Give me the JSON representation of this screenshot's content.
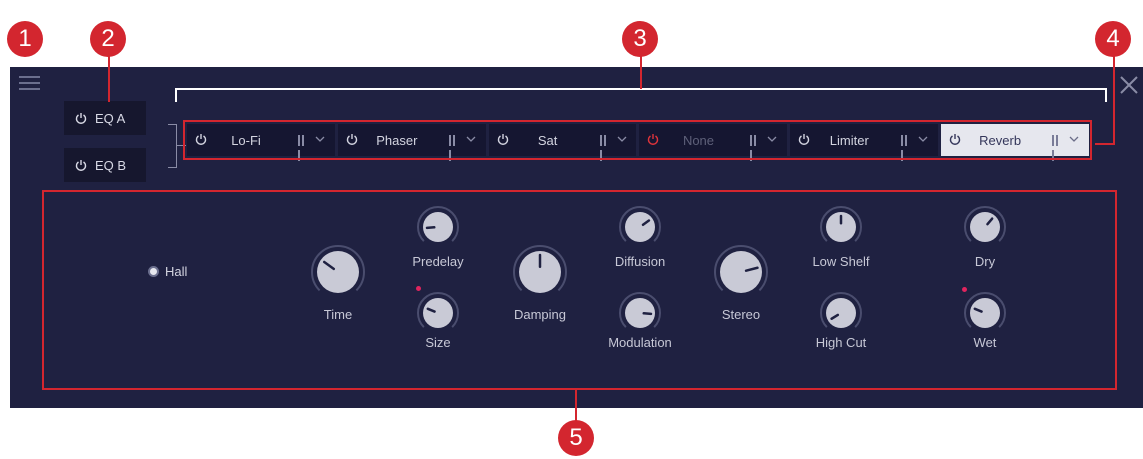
{
  "colors": {
    "panel": "#1f2141",
    "slot_bg": "#151631",
    "active_slot_bg": "#e6e7ee",
    "callout": "#d3262f",
    "modulation_dot": "#e0245e"
  },
  "icons": {
    "menu": "hamburger-icon",
    "close": "close-icon",
    "power": "power-icon",
    "bars": "bars-icon",
    "chevron": "chevron-down-icon"
  },
  "callouts": [
    "1",
    "2",
    "3",
    "4",
    "5"
  ],
  "eq": [
    {
      "label": "EQ A"
    },
    {
      "label": "EQ B"
    }
  ],
  "slots": [
    {
      "label": "Lo-Fi",
      "power": "on",
      "state": "normal"
    },
    {
      "label": "Phaser",
      "power": "on",
      "state": "normal"
    },
    {
      "label": "Sat",
      "power": "on",
      "state": "normal"
    },
    {
      "label": "None",
      "power": "off",
      "state": "empty"
    },
    {
      "label": "Limiter",
      "power": "on",
      "state": "normal"
    },
    {
      "label": "Reverb",
      "power": "on",
      "state": "selected"
    }
  ],
  "reverb": {
    "mode_label": "Hall",
    "knobs": {
      "time": {
        "label": "Time",
        "value": 0.3
      },
      "predelay": {
        "label": "Predelay",
        "value": 0.15
      },
      "size": {
        "label": "Size",
        "value": 0.25
      },
      "damping": {
        "label": "Damping",
        "value": 0.5
      },
      "diffusion": {
        "label": "Diffusion",
        "value": 0.7
      },
      "modulation": {
        "label": "Modulation",
        "value": 0.85
      },
      "stereo": {
        "label": "Stereo",
        "value": 0.78
      },
      "low_shelf": {
        "label": "Low Shelf",
        "value": 0.5
      },
      "high_cut": {
        "label": "High Cut",
        "value": 0.05
      },
      "dry": {
        "label": "Dry",
        "value": 0.65
      },
      "wet": {
        "label": "Wet",
        "value": 0.25
      }
    }
  }
}
